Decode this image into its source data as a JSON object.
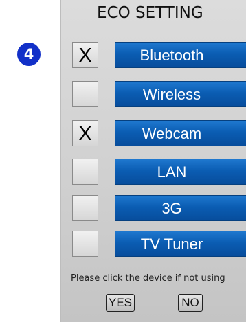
{
  "step_badge": {
    "number": "4",
    "color": "#1230c8"
  },
  "panel": {
    "title": "ECO SETTING",
    "devices": [
      {
        "label": "Bluetooth",
        "checked": true,
        "mark": "X"
      },
      {
        "label": "Wireless",
        "checked": false,
        "mark": ""
      },
      {
        "label": "Webcam",
        "checked": true,
        "mark": "X"
      },
      {
        "label": "LAN",
        "checked": false,
        "mark": ""
      },
      {
        "label": "3G",
        "checked": false,
        "mark": ""
      },
      {
        "label": "TV Tuner",
        "checked": false,
        "mark": ""
      }
    ],
    "instruction": "Please click the device if not using",
    "yes_label": "YES",
    "no_label": "NO"
  },
  "colors": {
    "device_button": "#0b5db3",
    "panel_background": "#d3d3d3"
  }
}
